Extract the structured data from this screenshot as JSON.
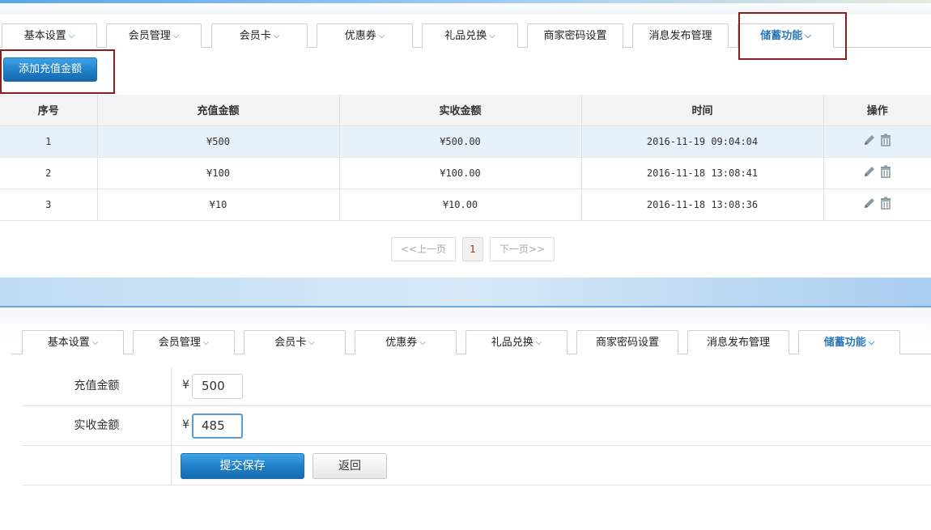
{
  "tabs": [
    {
      "label": "基本设置",
      "dropdown": true
    },
    {
      "label": "会员管理",
      "dropdown": true
    },
    {
      "label": "会员卡",
      "dropdown": true
    },
    {
      "label": "优惠券",
      "dropdown": true
    },
    {
      "label": "礼品兑换",
      "dropdown": true
    },
    {
      "label": "商家密码设置",
      "dropdown": false
    },
    {
      "label": "消息发布管理",
      "dropdown": false
    },
    {
      "label": "储蓄功能",
      "dropdown": true,
      "active": true
    }
  ],
  "list_view": {
    "add_button": "添加充值金额",
    "columns": [
      "序号",
      "充值金额",
      "实收金额",
      "时间",
      "操作"
    ],
    "rows": [
      {
        "no": "1",
        "amount": "¥500",
        "received": "¥500.00",
        "time": "2016-11-19 09:04:04"
      },
      {
        "no": "2",
        "amount": "¥100",
        "received": "¥100.00",
        "time": "2016-11-18 13:08:41"
      },
      {
        "no": "3",
        "amount": "¥10",
        "received": "¥10.00",
        "time": "2016-11-18 13:08:36"
      }
    ],
    "pager": {
      "prev": "<<上一页",
      "current": "1",
      "next": "下一页>>"
    }
  },
  "form_view": {
    "currency": "¥",
    "fields": [
      {
        "label": "充值金额",
        "value": "500"
      },
      {
        "label": "实收金额",
        "value": "485"
      }
    ],
    "submit": "提交保存",
    "back": "返回"
  },
  "colors": {
    "accent": "#2b77b7",
    "highlight_box": "#8b1d1d",
    "row_highlight": "#e6f1fa"
  },
  "icons": {
    "edit": "pencil-icon",
    "delete": "trash-icon",
    "dropdown": "chevron-down-icon"
  }
}
